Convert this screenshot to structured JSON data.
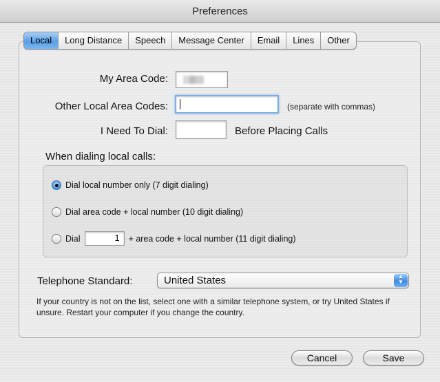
{
  "window": {
    "title": "Preferences"
  },
  "tabs": [
    {
      "label": "Local",
      "selected": true
    },
    {
      "label": "Long Distance"
    },
    {
      "label": "Speech"
    },
    {
      "label": "Message Center"
    },
    {
      "label": "Email"
    },
    {
      "label": "Lines"
    },
    {
      "label": "Other"
    }
  ],
  "form": {
    "area_code_label": "My Area Code:",
    "other_codes_label": "Other Local Area Codes:",
    "other_codes_value": "",
    "other_codes_hint": "(separate with commas)",
    "need_to_dial_label": "I Need To Dial:",
    "need_to_dial_value": "",
    "before_placing_label": "Before Placing Calls"
  },
  "dialing": {
    "heading": "When dialing local calls:",
    "options": [
      {
        "label": "Dial local number only (7 digit dialing)",
        "checked": true
      },
      {
        "label": "Dial area code + local number (10 digit dialing)",
        "checked": false
      },
      {
        "label_prefix": "Dial",
        "value": "1",
        "label_suffix": "+ area code + local number (11 digit dialing)",
        "checked": false
      }
    ]
  },
  "telephone_standard": {
    "label": "Telephone Standard:",
    "selected": "United States",
    "help": "If your country is not on the list, select one with a similar telephone system, or try United States if unsure. Restart your computer if you change the country."
  },
  "buttons": {
    "cancel": "Cancel",
    "save": "Save"
  },
  "colors": {
    "accent": "#5aa0e6",
    "focus_ring": "#7eaee0"
  }
}
